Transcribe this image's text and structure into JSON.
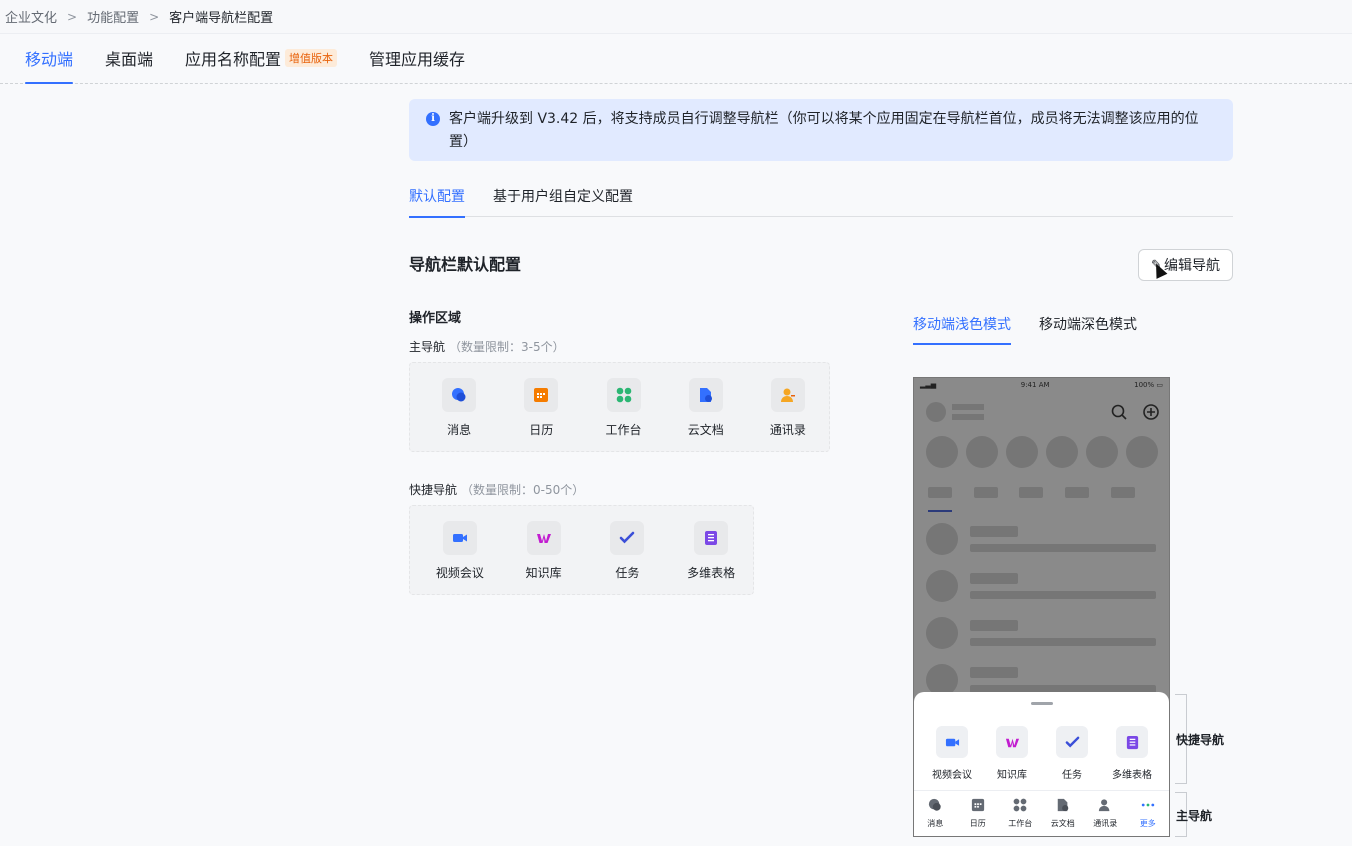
{
  "breadcrumb": {
    "items": [
      "企业文化",
      "功能配置",
      "客户端导航栏配置"
    ],
    "separator": ">"
  },
  "top_tabs": [
    {
      "label": "移动端",
      "active": true
    },
    {
      "label": "桌面端"
    },
    {
      "label": "应用名称配置",
      "badge": "增值版本"
    },
    {
      "label": "管理应用缓存"
    }
  ],
  "alert": {
    "icon": "info-icon",
    "icon_glyph": "i",
    "text": "客户端升级到 V3.42 后，将支持成员自行调整导航栏（你可以将某个应用固定在导航栏首位，成员将无法调整该应用的位置）"
  },
  "sub_tabs": [
    {
      "label": "默认配置",
      "active": true
    },
    {
      "label": "基于用户组自定义配置"
    }
  ],
  "section": {
    "title": "导航栏默认配置",
    "edit_button": "编辑导航",
    "edit_icon": "✎"
  },
  "operation_area": {
    "title": "操作区域",
    "main_nav": {
      "label": "主导航",
      "limit": "（数量限制：3-5个）",
      "items": [
        {
          "label": "消息",
          "icon": "message-icon"
        },
        {
          "label": "日历",
          "icon": "calendar-icon"
        },
        {
          "label": "工作台",
          "icon": "workplace-icon"
        },
        {
          "label": "云文档",
          "icon": "cloud-docs-icon"
        },
        {
          "label": "通讯录",
          "icon": "contacts-icon"
        }
      ]
    },
    "quick_nav": {
      "label": "快捷导航",
      "limit": "（数量限制：0-50个）",
      "items": [
        {
          "label": "视频会议",
          "icon": "video-meeting-icon"
        },
        {
          "label": "知识库",
          "icon": "wiki-icon"
        },
        {
          "label": "任务",
          "icon": "task-icon"
        },
        {
          "label": "多维表格",
          "icon": "bitable-icon"
        }
      ]
    }
  },
  "preview": {
    "tabs": [
      {
        "label": "移动端浅色模式",
        "active": true
      },
      {
        "label": "移动端深色模式"
      }
    ],
    "status_time": "9:41 AM",
    "status_battery": "100%",
    "quick_items": [
      "视频会议",
      "知识库",
      "任务",
      "多维表格"
    ],
    "tabbar_items": [
      "消息",
      "日历",
      "工作台",
      "云文档",
      "通讯录",
      "更多"
    ],
    "quick_label": "快捷导航",
    "main_label": "主导航"
  },
  "colors": {
    "accent": "#3370ff",
    "badge_bg": "#fdebd9",
    "badge_text": "#e8620b",
    "alert_bg": "#e1eaff"
  }
}
